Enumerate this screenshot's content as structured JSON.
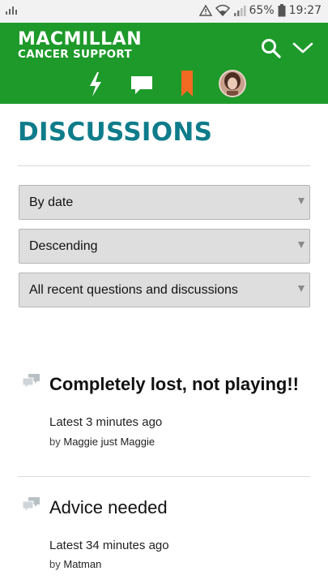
{
  "status_bar": {
    "battery": "65%",
    "time": "19:27"
  },
  "header": {
    "logo_line1": "MACMILLAN",
    "logo_line2": "CANCER SUPPORT",
    "icons": [
      "search-icon",
      "chevron-down-icon",
      "lightning-icon",
      "chat-bubble-icon",
      "bookmark-icon",
      "avatar"
    ]
  },
  "page": {
    "title": "DISCUSSIONS"
  },
  "filters": {
    "sort_by": "By date",
    "order": "Descending",
    "scope": "All recent questions and discussions"
  },
  "discussions": [
    {
      "title": "Completely lost, not playing!!",
      "latest": "Latest 3 minutes ago",
      "by_prefix": "by",
      "author": "Maggie just Maggie"
    },
    {
      "title": "Advice needed",
      "latest": "Latest 34 minutes ago",
      "by_prefix": "by",
      "author": "Matman"
    }
  ],
  "colors": {
    "brand_green": "#1d9a2a",
    "title_teal": "#0e7c8a",
    "bookmark_orange": "#f26a21"
  }
}
